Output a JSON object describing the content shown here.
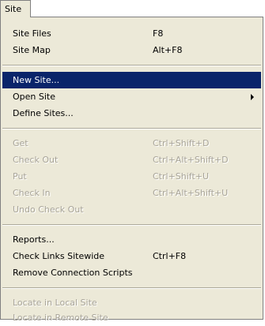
{
  "menubar": {
    "title": "Site"
  },
  "menu": {
    "items": [
      {
        "label": "Site Files",
        "shortcut": "F8"
      },
      {
        "label": "Site Map",
        "shortcut": "Alt+F8"
      },
      {
        "label": "New Site...",
        "shortcut": ""
      },
      {
        "label": "Open Site",
        "shortcut": ""
      },
      {
        "label": "Define Sites...",
        "shortcut": ""
      },
      {
        "label": "Get",
        "shortcut": "Ctrl+Shift+D"
      },
      {
        "label": "Check Out",
        "shortcut": "Ctrl+Alt+Shift+D"
      },
      {
        "label": "Put",
        "shortcut": "Ctrl+Shift+U"
      },
      {
        "label": "Check In",
        "shortcut": "Ctrl+Alt+Shift+U"
      },
      {
        "label": "Undo Check Out",
        "shortcut": ""
      },
      {
        "label": "Reports...",
        "shortcut": ""
      },
      {
        "label": "Check Links Sitewide",
        "shortcut": "Ctrl+F8"
      },
      {
        "label": "Remove Connection Scripts",
        "shortcut": ""
      },
      {
        "label": "Locate in Local Site",
        "shortcut": ""
      },
      {
        "label": "Locate in Remote Site",
        "shortcut": ""
      }
    ]
  },
  "colors": {
    "menu_background": "#ece9d8",
    "highlight": "#0a246a",
    "disabled_text": "#a8a498"
  }
}
